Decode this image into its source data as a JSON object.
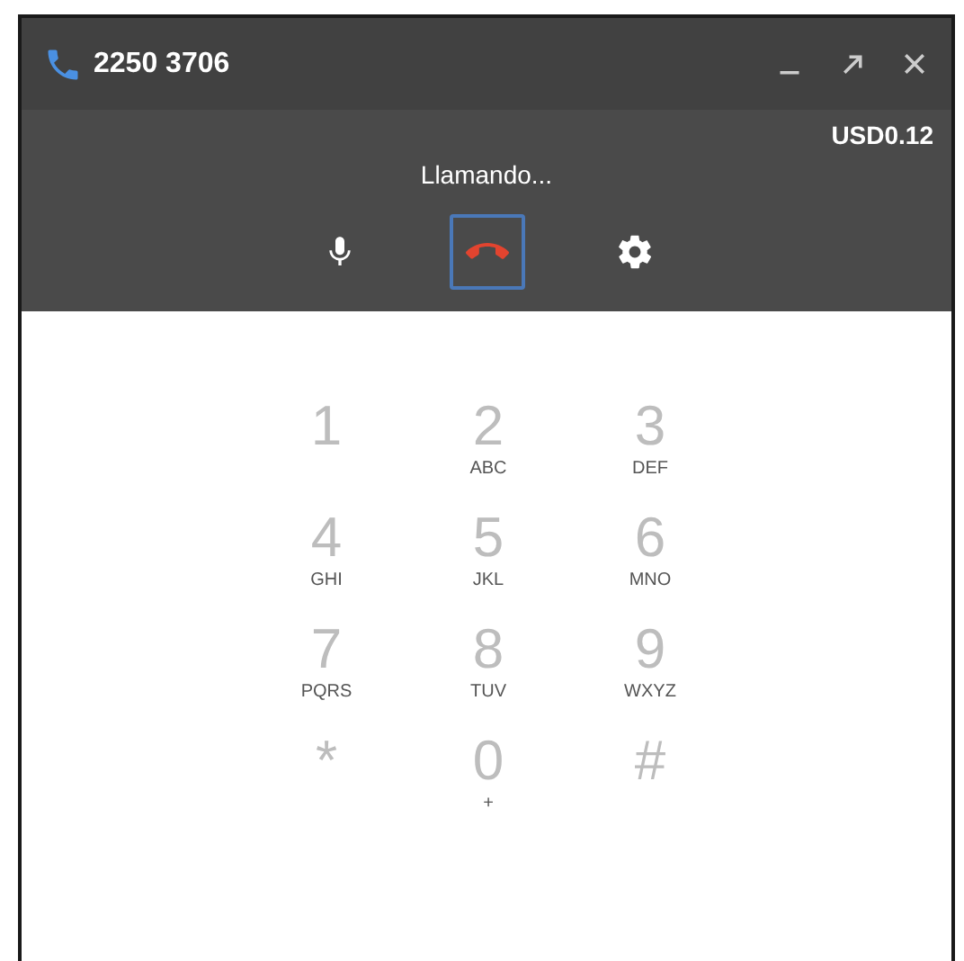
{
  "window": {
    "title": "2250 3706"
  },
  "call": {
    "cost": "USD0.12",
    "status": "Llamando..."
  },
  "keypad": [
    {
      "digit": "1"
    },
    {
      "digit": "2",
      "letters": "ABC"
    },
    {
      "digit": "3",
      "letters": "DEF"
    },
    {
      "digit": "4",
      "letters": "GHI"
    },
    {
      "digit": "5",
      "letters": "JKL"
    },
    {
      "digit": "6",
      "letters": "MNO"
    },
    {
      "digit": "7",
      "letters": "PQRS"
    },
    {
      "digit": "8",
      "letters": "TUV"
    },
    {
      "digit": "9",
      "letters": "WXYZ"
    },
    {
      "digit": "*"
    },
    {
      "digit": "0",
      "letters": "+"
    },
    {
      "digit": "#"
    }
  ]
}
